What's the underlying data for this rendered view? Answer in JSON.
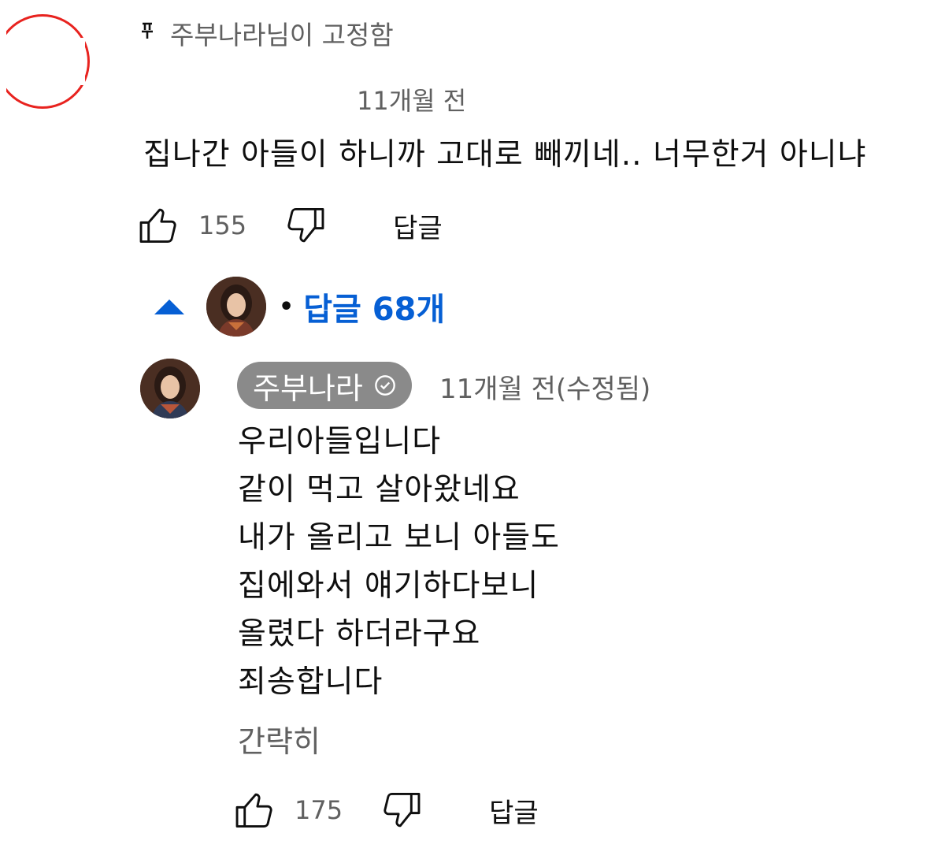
{
  "pinned": {
    "icon": "pin-icon",
    "label": "주부나라님이 고정함"
  },
  "main_comment": {
    "time": "11개월 전",
    "text": "집나간 아들이 하니까 고대로 빼끼네.. 너무한거 아니냐",
    "likes": "155",
    "reply_label": "답글"
  },
  "replies_toggle": {
    "label": "답글 68개",
    "caret_color": "#065fd4"
  },
  "reply": {
    "author": "주부나라",
    "verified_icon": "verified-check-icon",
    "time": "11개월 전(수정됨)",
    "lines": [
      "우리아들입니다",
      "같이 먹고 살아왔네요",
      "내가 올리고 보니 아들도",
      "집에와서 얘기하다보니",
      "올렸다 하더라구요",
      "죄송합니다"
    ],
    "collapse_label": "간략히",
    "likes": "175",
    "reply_label": "답글"
  },
  "colors": {
    "accent_link": "#065fd4",
    "muted_text": "#606060",
    "author_chip_bg": "#8a8a8a",
    "avatar_rim": "#e8231f"
  }
}
